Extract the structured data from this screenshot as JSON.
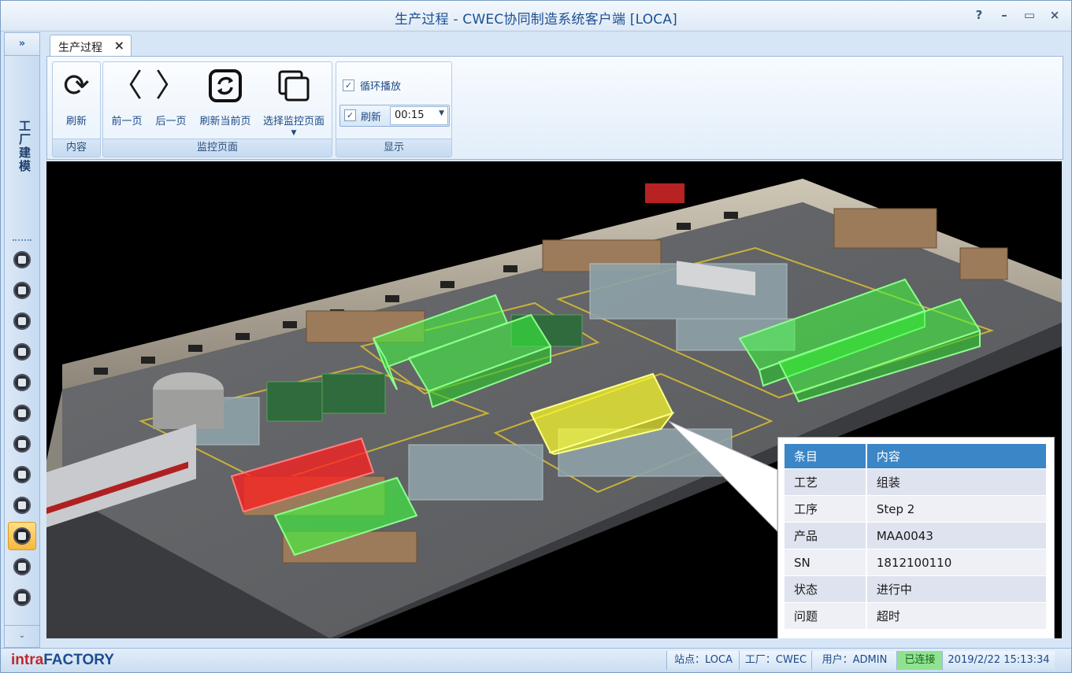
{
  "window": {
    "title": "生产过程 - CWEC协同制造系统客户端 [LOCA]",
    "controls": [
      "?",
      "–",
      "▭",
      "×"
    ]
  },
  "leftbar": {
    "expand": "»",
    "vertical_label": "工厂建模",
    "more": "⌄",
    "active_index": 9,
    "icons": [
      "tools-icon",
      "database-icon",
      "back-arrow-icon",
      "user-icon",
      "chart-icon",
      "cart-icon",
      "process-icon",
      "link-icon",
      "filter-icon",
      "monitor-icon",
      "alert-icon",
      "report-icon"
    ]
  },
  "tab": {
    "label": "生产过程",
    "close": "×"
  },
  "ribbon": {
    "groups": {
      "content": "内容",
      "monitor": "监控页面",
      "display": "显示"
    },
    "buttons": {
      "refresh": "刷新",
      "prev": "前一页",
      "next": "后一页",
      "refresh_current": "刷新当前页",
      "select_monitor": "选择监控页面"
    },
    "loop_play": {
      "label": "循环播放",
      "checked": true
    },
    "auto_refresh": {
      "label": "刷新",
      "checked": true,
      "interval": "00:15"
    }
  },
  "popup": {
    "headers": [
      "条目",
      "内容"
    ],
    "rows": [
      [
        "工艺",
        "组装"
      ],
      [
        "工序",
        "Step 2"
      ],
      [
        "产品",
        "MAA0043"
      ],
      [
        "SN",
        "1812100110"
      ],
      [
        "状态",
        "进行中"
      ],
      [
        "问题",
        "超时"
      ]
    ]
  },
  "statusbar": {
    "brand_a": "intra",
    "brand_b": "FACTORY",
    "station": "站点：LOCA",
    "factory": "工厂：CWEC",
    "user": "用户：ADMIN",
    "connection": "已连接",
    "datetime": "2019/2/22 15:13:34"
  },
  "colors": {
    "accent": "#3b86c6",
    "zone_ok": "#3cff3c",
    "zone_warn": "#ffff33",
    "zone_alarm": "#ff2222"
  }
}
